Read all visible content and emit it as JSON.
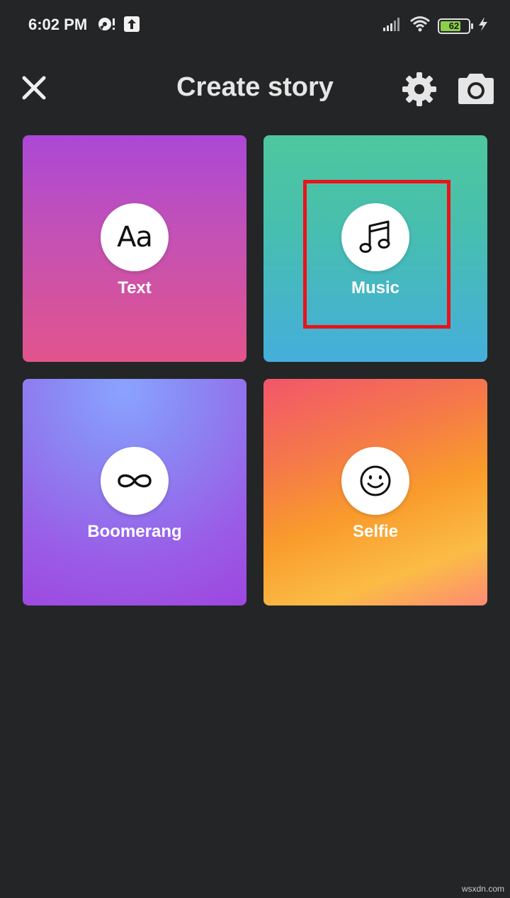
{
  "status_bar": {
    "time": "6:02 PM",
    "battery_level": "62",
    "icons": [
      "notification-icon",
      "upload-icon",
      "signal-icon",
      "wifi-icon",
      "battery-icon",
      "charging-icon"
    ]
  },
  "header": {
    "title": "Create story",
    "close_icon": "close-icon",
    "settings_icon": "gear-icon",
    "camera_icon": "camera-icon"
  },
  "tiles": [
    {
      "label": "Text",
      "icon": "text-aa-icon",
      "glyph": "Aa"
    },
    {
      "label": "Music",
      "icon": "music-note-icon"
    },
    {
      "label": "Boomerang",
      "icon": "infinity-icon"
    },
    {
      "label": "Selfie",
      "icon": "smiley-icon"
    }
  ],
  "colors": {
    "background": "#242527",
    "highlight": "#e8141a",
    "text_tile": "#c451b4",
    "music_tile": "#47bfae",
    "boomerang_tile": "#9a5ce6",
    "selfie_tile": "#f99b2c"
  },
  "watermark": "wsxdn.com"
}
